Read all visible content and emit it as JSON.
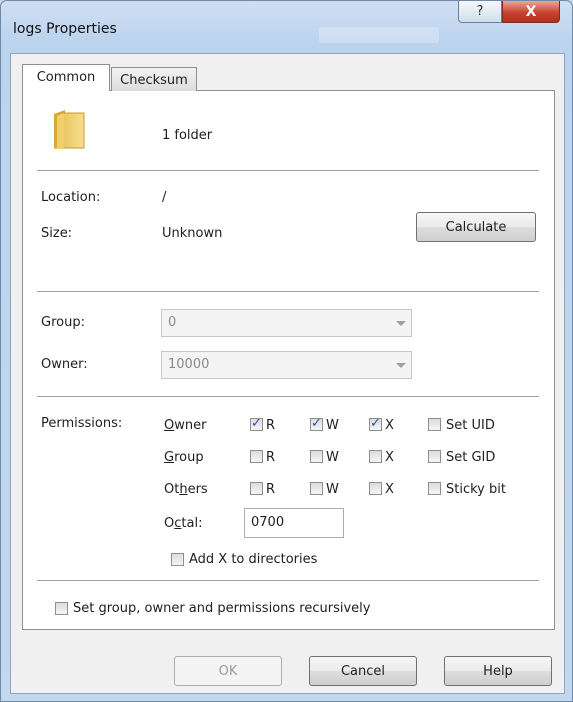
{
  "window": {
    "title": "logs Properties",
    "help_glyph": "?",
    "close_glyph": "X"
  },
  "tabs": [
    {
      "label": "Common"
    },
    {
      "label": "Checksum"
    }
  ],
  "summary": {
    "text": "1 folder"
  },
  "info": {
    "location_label": "Location:",
    "location_value": "/",
    "size_label": "Size:",
    "size_value": "Unknown",
    "calculate_label": "Calculate"
  },
  "group": {
    "label": "Group:",
    "value": "0"
  },
  "owner": {
    "label": "Owner:",
    "value": "10000"
  },
  "permissions": {
    "label": "Permissions:",
    "rows": [
      {
        "pre": "",
        "key": "O",
        "post": "wner",
        "r": true,
        "w": true,
        "x": true,
        "special": "Set UID",
        "special_checked": false
      },
      {
        "pre": "",
        "key": "G",
        "post": "roup",
        "r": false,
        "w": false,
        "x": false,
        "special": "Set GID",
        "special_checked": false
      },
      {
        "pre": "Ot",
        "key": "h",
        "post": "ers",
        "r": false,
        "w": false,
        "x": false,
        "special": "Sticky bit",
        "special_checked": false
      }
    ],
    "r_label": "R",
    "w_label": "W",
    "x_label": "X",
    "octal_pre": "O",
    "octal_key": "c",
    "octal_post": "tal:",
    "octal_value": "0700",
    "add_x_label": "Add X to directories",
    "add_x_checked": false
  },
  "recursive": {
    "label": "Set group, owner and permissions recursively",
    "checked": false
  },
  "buttons": {
    "ok": "OK",
    "cancel": "Cancel",
    "help": "Help"
  },
  "colors": {
    "titlebar": "#c3d7ee",
    "close": "#c7432f",
    "check": "#2b4ea8"
  }
}
